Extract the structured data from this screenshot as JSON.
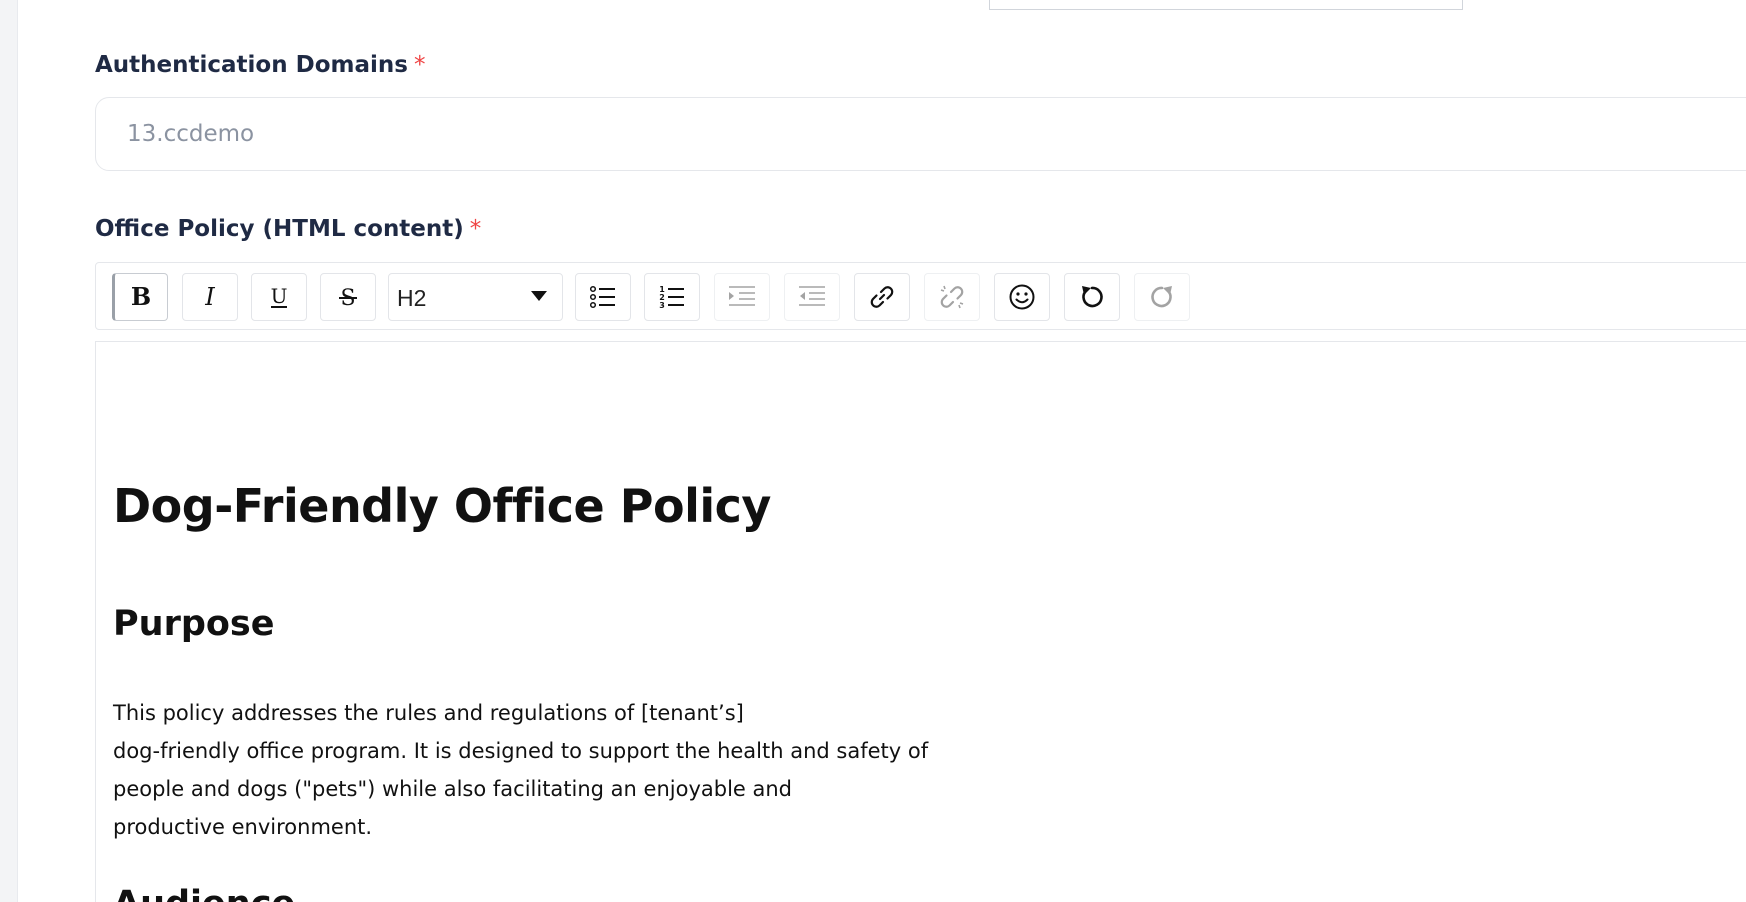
{
  "form": {
    "auth_domains": {
      "label": "Authentication Domains",
      "required_mark": "*",
      "placeholder": "13.ccdemo"
    },
    "office_policy": {
      "label": "Office Policy (HTML content)",
      "required_mark": "*"
    }
  },
  "toolbar": {
    "buttons": [
      {
        "name": "bold",
        "icon": "bold-icon",
        "active": true
      },
      {
        "name": "italic",
        "icon": "italic-icon"
      },
      {
        "name": "underline",
        "icon": "underline-icon"
      },
      {
        "name": "strikethrough",
        "icon": "strikethrough-icon"
      },
      {
        "name": "bullet-list",
        "icon": "bullet-list-icon"
      },
      {
        "name": "numbered-list",
        "icon": "numbered-list-icon"
      },
      {
        "name": "indent",
        "icon": "indent-icon",
        "disabled": true
      },
      {
        "name": "outdent",
        "icon": "outdent-icon",
        "disabled": true
      },
      {
        "name": "link",
        "icon": "link-icon"
      },
      {
        "name": "unlink",
        "icon": "unlink-icon",
        "disabled": true
      },
      {
        "name": "emoji",
        "icon": "emoji-icon"
      },
      {
        "name": "undo",
        "icon": "undo-icon"
      },
      {
        "name": "redo",
        "icon": "redo-icon",
        "disabled": true
      }
    ],
    "heading_select": {
      "value": "H2"
    }
  },
  "editor": {
    "title": "Dog-Friendly Office Policy",
    "section_purpose": {
      "heading": "Purpose",
      "lines": [
        "This policy addresses the rules and regulations of [tenant’s]",
        "dog-friendly office program. It is designed to support the health and safety of",
        "people and dogs (\"pets\") while also facilitating an enjoyable and",
        "productive environment."
      ]
    },
    "section_audience": {
      "heading": "Audience"
    }
  },
  "colors": {
    "label_text": "#1f2a44",
    "required": "#ef4444",
    "placeholder": "#8b93a1",
    "border": "#e5e7eb",
    "rail": "#f3f4f6"
  }
}
